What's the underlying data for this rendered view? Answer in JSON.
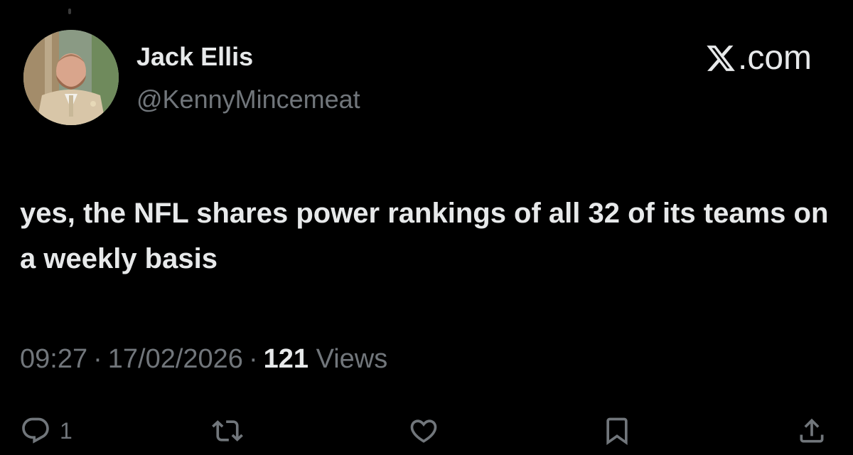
{
  "author": {
    "display_name": "Jack Ellis",
    "handle": "@KennyMincemeat"
  },
  "brand": {
    "logo_icon": "x-logo-icon",
    "text": ".com"
  },
  "tweet": {
    "text": "yes, the NFL shares power rankings of all 32 of its teams on a weekly basis",
    "time": "09:27",
    "separator": "·",
    "date": "17/02/2026",
    "views_count": "121",
    "views_label": "Views"
  },
  "actions": {
    "reply": {
      "icon": "reply-icon",
      "count": "1"
    },
    "retweet": {
      "icon": "retweet-icon"
    },
    "like": {
      "icon": "heart-icon"
    },
    "bookmark": {
      "icon": "bookmark-icon"
    },
    "share": {
      "icon": "share-icon"
    }
  },
  "colors": {
    "background": "#000000",
    "primary_text": "#e7e9ea",
    "secondary_text": "#71767b"
  }
}
